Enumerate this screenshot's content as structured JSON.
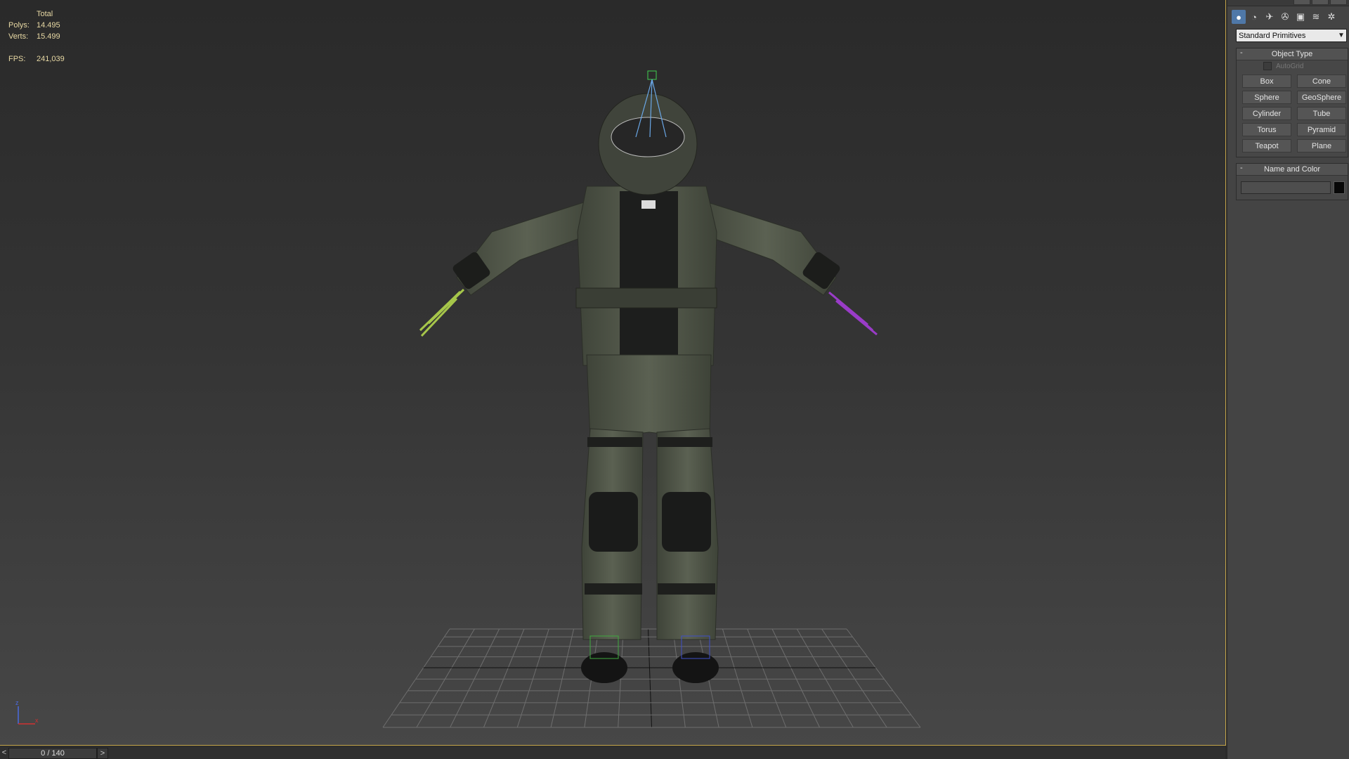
{
  "viewport_stats": {
    "total_label": "Total",
    "polys_label": "Polys:",
    "polys_value": "14.495",
    "verts_label": "Verts:",
    "verts_value": "15.499",
    "fps_label": "FPS:",
    "fps_value": "241,039"
  },
  "axis_gizmo": {
    "z_label": "z",
    "x_label": "x"
  },
  "command_panel": {
    "icons": [
      "create-geometry-icon",
      "shapes-icon",
      "lights-icon",
      "cameras-icon",
      "helpers-icon",
      "spacewarps-icon",
      "systems-icon"
    ],
    "category_dropdown": "Standard Primitives",
    "object_type": {
      "title": "Object Type",
      "collapse_symbol": "-",
      "autogrid_label": "AutoGrid",
      "buttons": [
        "Box",
        "Cone",
        "Sphere",
        "GeoSphere",
        "Cylinder",
        "Tube",
        "Torus",
        "Pyramid",
        "Teapot",
        "Plane"
      ]
    },
    "name_and_color": {
      "title": "Name and Color",
      "collapse_symbol": "-",
      "name_value": "",
      "color": "#080808"
    }
  },
  "timeline": {
    "prev_symbol": "<",
    "next_symbol": ">",
    "frame_label": "0 / 140"
  },
  "colors": {
    "accent_border": "#c6a64a",
    "active_tab": "#4f78a8",
    "stats_text": "#e8d9a4"
  }
}
